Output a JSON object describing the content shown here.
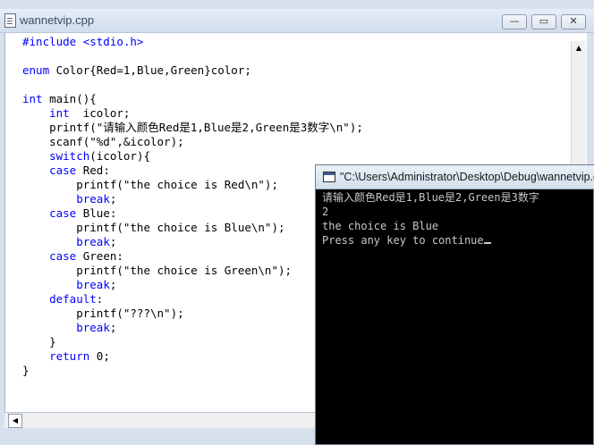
{
  "editor": {
    "title": "wannetvip.cpp",
    "buttons": {
      "minimize": "—",
      "restore": "▭",
      "close": "✕"
    },
    "code_lines": [
      [
        {
          "t": "#include <stdio.h>",
          "k": "kw"
        }
      ],
      [],
      [
        {
          "t": "enum",
          "k": "kw"
        },
        {
          "t": " Color{Red=1,Blue,Green}color;"
        }
      ],
      [],
      [
        {
          "t": "int",
          "k": "kw"
        },
        {
          "t": " main(){"
        }
      ],
      [
        {
          "t": "    "
        },
        {
          "t": "int",
          "k": "kw"
        },
        {
          "t": "  icolor;"
        }
      ],
      [
        {
          "t": "    printf(\"请输入颜色Red是1,Blue是2,Green是3数字\\n\");"
        }
      ],
      [
        {
          "t": "    scanf(\"%d\",&icolor);"
        }
      ],
      [
        {
          "t": "    "
        },
        {
          "t": "switch",
          "k": "kw"
        },
        {
          "t": "(icolor){"
        }
      ],
      [
        {
          "t": "    "
        },
        {
          "t": "case",
          "k": "kw"
        },
        {
          "t": " Red:"
        }
      ],
      [
        {
          "t": "        printf(\"the choice is Red\\n\");"
        }
      ],
      [
        {
          "t": "        "
        },
        {
          "t": "break",
          "k": "kw"
        },
        {
          "t": ";"
        }
      ],
      [
        {
          "t": "    "
        },
        {
          "t": "case",
          "k": "kw"
        },
        {
          "t": " Blue:"
        }
      ],
      [
        {
          "t": "        printf(\"the choice is Blue\\n\");"
        }
      ],
      [
        {
          "t": "        "
        },
        {
          "t": "break",
          "k": "kw"
        },
        {
          "t": ";"
        }
      ],
      [
        {
          "t": "    "
        },
        {
          "t": "case",
          "k": "kw"
        },
        {
          "t": " Green:"
        }
      ],
      [
        {
          "t": "        printf(\"the choice is Green\\n\");"
        }
      ],
      [
        {
          "t": "        "
        },
        {
          "t": "break",
          "k": "kw"
        },
        {
          "t": ";"
        }
      ],
      [
        {
          "t": "    "
        },
        {
          "t": "default",
          "k": "kw"
        },
        {
          "t": ":"
        }
      ],
      [
        {
          "t": "        printf(\"???\\n\");"
        }
      ],
      [
        {
          "t": "        "
        },
        {
          "t": "break",
          "k": "kw"
        },
        {
          "t": ";"
        }
      ],
      [
        {
          "t": "    }"
        }
      ],
      [
        {
          "t": "    "
        },
        {
          "t": "return",
          "k": "kw"
        },
        {
          "t": " 0;"
        }
      ],
      [
        {
          "t": "}"
        }
      ]
    ],
    "scroll_up_icon": "▲",
    "scroll_left_icon": "◀"
  },
  "console": {
    "title": "\"C:\\Users\\Administrator\\Desktop\\Debug\\wannetvip.exe\"",
    "lines": [
      "请输入颜色Red是1,Blue是2,Green是3数字",
      "2",
      "the choice is Blue",
      "Press any key to continue"
    ]
  },
  "colors": {
    "keyword": "#0000ff",
    "console_bg": "#000000",
    "console_text": "#c8c8c8"
  }
}
